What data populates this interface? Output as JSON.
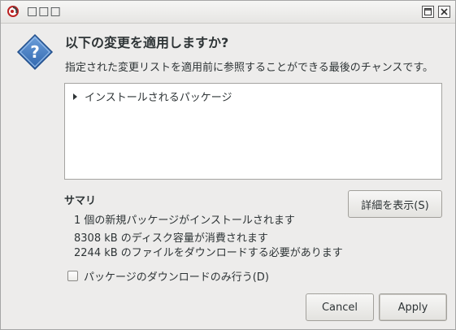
{
  "window": {
    "title": "□□□"
  },
  "dialog": {
    "heading": "以下の変更を適用しますか?",
    "subtext": "指定された変更リストを適用前に参照することができる最後のチャンスです。"
  },
  "package_tree": {
    "rows": [
      {
        "label": "インストールされるパッケージ",
        "expanded": false
      }
    ]
  },
  "summary": {
    "title": "サマリ",
    "lines": [
      "1 個の新規パッケージがインストールされます",
      "8308 kB のディスク容量が消費されます",
      "2244 kB のファイルをダウンロードする必要があります"
    ]
  },
  "buttons": {
    "details": "詳細を表示(S)",
    "cancel": "Cancel",
    "apply": "Apply"
  },
  "options": {
    "download_only_label": "パッケージのダウンロードのみ行う(D)",
    "download_only_checked": false
  },
  "icons": {
    "app": "debian-swirl-icon",
    "question": "question-icon",
    "maximize": "maximize-icon",
    "close": "close-icon"
  },
  "colors": {
    "question_icon_blue": "#3f7bc4",
    "window_bg": "#edeceb"
  }
}
